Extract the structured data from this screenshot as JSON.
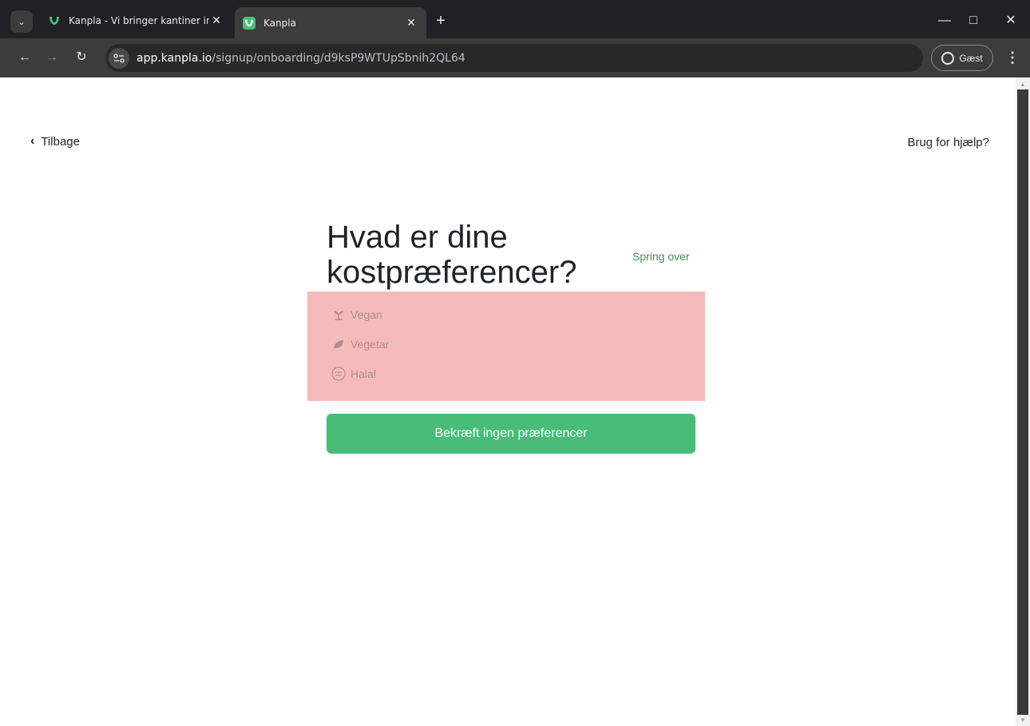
{
  "browser": {
    "tabs": [
      {
        "title": "Kanpla - Vi bringer kantiner ind",
        "active": false
      },
      {
        "title": "Kanpla",
        "active": true
      }
    ],
    "new_tab_label": "+",
    "address": {
      "domain": "app.kanpla.io",
      "path": "/signup/onboarding/d9ksP9WTUpSbnih2QL64"
    },
    "profile_label": "Gæst"
  },
  "page": {
    "back_label": "Tilbage",
    "help_label": "Brug for hjælp?",
    "heading": "Hvad er dine kostpræferencer?",
    "skip_label": "Spring over",
    "preferences": [
      {
        "label": "Vegan",
        "icon": "sprout-icon"
      },
      {
        "label": "Vegetar",
        "icon": "leaf-icon"
      },
      {
        "label": "Halal",
        "icon": "halal-icon"
      }
    ],
    "confirm_label": "Bekræft ingen præferencer"
  },
  "colors": {
    "brand_green": "#48bd78",
    "skip_green": "#3f8f55",
    "panel_pink": "#f5bbbb"
  }
}
